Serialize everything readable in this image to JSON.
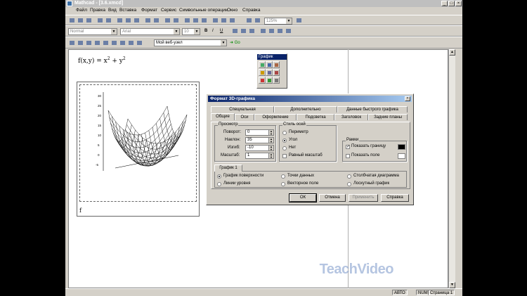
{
  "window": {
    "title": "Mathcad - [3.6.xmcd]"
  },
  "menu": [
    "Файл",
    "Правка",
    "Вид",
    "Вставка",
    "Формат",
    "Сервис",
    "Символьные операции",
    "Окно",
    "Справка"
  ],
  "toolbar": {
    "style_value": "Normal",
    "font_value": "Arial",
    "size_value": "10",
    "zoom_value": "125%",
    "bold": "B",
    "italic": "I",
    "underline": "U",
    "web_value": "Мой веб-узел",
    "go_label": "Go"
  },
  "worksheet": {
    "formula_lhs": "f(x,y) = x",
    "formula_exp1": "2",
    "formula_plus": " + y",
    "formula_exp2": "2",
    "plot_label": "f",
    "z_ticks": [
      "30",
      "25",
      "20",
      "15",
      "10",
      "5",
      "0",
      "-5"
    ]
  },
  "palette": {
    "title": "График"
  },
  "dialog": {
    "title": "Формат 3D-графика",
    "tabs_row1": [
      "Специальная",
      "Дополнительно",
      "Данные быстрого графика"
    ],
    "tabs_row2": [
      "Общие",
      "Оси",
      "Оформление",
      "Подсветка",
      "Заголовок",
      "Задние планы"
    ],
    "view_group": "Просмотр",
    "rotation_label": "Поворот:",
    "rotation_value": "0",
    "tilt_label": "Наклон:",
    "tilt_value": "35",
    "twist_label": "Изгиб:",
    "twist_value": "-10",
    "zoom_label": "Масштаб:",
    "zoom_value": "1",
    "axes_group": "Стиль осей",
    "axes_perimeter": "Периметр",
    "axes_corner": "Угол",
    "axes_none": "Нет",
    "equal_scale": "Равный масштаб",
    "frame_group": "Рамки",
    "show_border": "Показать границу",
    "show_field": "Показать поле",
    "graph_tab": "График 1",
    "plot_types": [
      "График поверхности",
      "Точки данных",
      "Столбчатая диаграмма",
      "Линии уровня",
      "Векторное поле",
      "Лоскутный график"
    ],
    "ok": "ОК",
    "cancel": "Отмена",
    "apply": "Применить",
    "help": "Справка"
  },
  "status": {
    "auto": "АВТО",
    "num": "NUM",
    "page": "Страница 1"
  },
  "watermark": "TeachVideo"
}
